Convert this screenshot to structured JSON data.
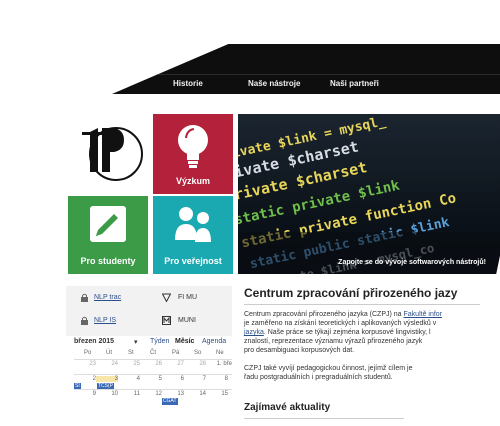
{
  "nav": {
    "items": [
      "Historie",
      "Naše nástroje",
      "Naši partneři"
    ]
  },
  "tiles": {
    "vyzkum": "Výzkum",
    "studenty": "Pro studenty",
    "verejnost": "Pro veřejnost"
  },
  "banner": {
    "caption": "Zapojte se do vývoje softwarových nástrojů!",
    "code_lines": [
      "private $link = mysql_",
      "private $charset",
      "private $charset",
      "static private $link",
      "static private function Co",
      "static public static $link",
      "private $link = mysql_co",
      "$link = mysql_co"
    ]
  },
  "links": [
    {
      "label": "NLP trac",
      "icon": "lock-icon"
    },
    {
      "label": "FI MU",
      "icon": "fimu-logo-icon"
    },
    {
      "label": "NLP IS",
      "icon": "lock-icon"
    },
    {
      "label": "MUNI",
      "icon": "muni-logo-icon"
    }
  ],
  "calendar": {
    "month": "březen 2015",
    "views": [
      "Týden",
      "Měsíc",
      "Agenda"
    ],
    "active_view": "Měsíc",
    "weekdays": [
      "Po",
      "Út",
      "St",
      "Čt",
      "Pá",
      "So",
      "Ne"
    ],
    "rows": [
      [
        "23",
        "24",
        "25",
        "26",
        "27",
        "28",
        "1. bře"
      ],
      [
        "2",
        "3",
        "4",
        "5",
        "6",
        "7",
        "8"
      ],
      [
        "9",
        "10",
        "11",
        "12",
        "13",
        "14",
        "15"
      ]
    ],
    "events": [
      "SI",
      "TCS(P",
      "CGAT"
    ]
  },
  "content": {
    "title": "Centrum zpracování přirozeného jazy",
    "p1_a": "Centrum zpracování přirozeného jazyka (CZPJ) na ",
    "p1_link1": "Fakultě infor",
    "p1_b": "je zaměřeno na získání teoretických i aplikovaných výsledků v",
    "p1_link2": "jazyka",
    "p1_c": ". Naše práce se týkají zejména korpusové lingvistiky, l",
    "p1_d": "znalostí, reprezentace významu výrazů přirozeného jazyk",
    "p1_e": "pro desambiguaci korpusových dat.",
    "p2_a": "CZPJ také vyvíjí pedagogickou činnost, jejímž cílem je",
    "p2_b": "řadu postgraduálních i pregraduálních studentů.",
    "news_heading": "Zajímavé aktuality"
  },
  "colors": {
    "vyzkum": "#b3213a",
    "studenty": "#3b9b47",
    "verejnost": "#1ba9b1",
    "link": "#2b4f8a"
  }
}
